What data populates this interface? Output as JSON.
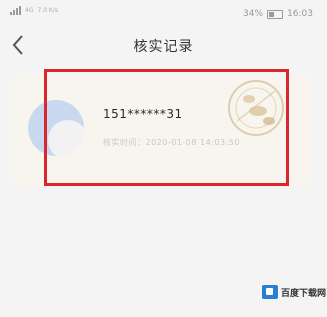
{
  "status_bar": {
    "network_label": "4G",
    "speed": "7.0 K/s",
    "battery_percent": "34%",
    "time": "16:03"
  },
  "header": {
    "title": "核实记录"
  },
  "record": {
    "phone": "151******31",
    "detail": "核实时间：2020-01-08 14:03:50"
  },
  "watermark": {
    "text": "百度下载网"
  },
  "colors": {
    "highlight_border": "#d9272d",
    "card_background": "#f8f5ef",
    "page_background": "#f4f4f4"
  }
}
